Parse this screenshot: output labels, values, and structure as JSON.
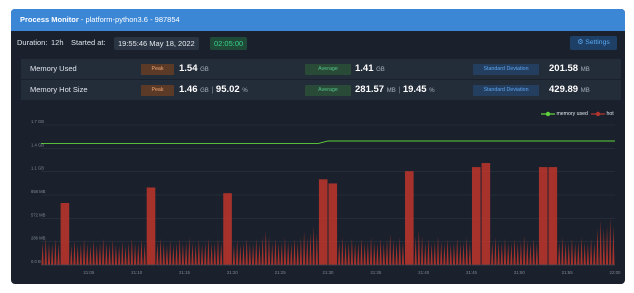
{
  "titlebar": {
    "app_name": "Process Monitor",
    "separator": " - ",
    "process": "platform-python3.6",
    "pid": "987854"
  },
  "toolbar": {
    "duration_label": "Duration:",
    "duration_value": "12h",
    "started_label": "Started at:",
    "started_value": "19:55:46 May 18, 2022",
    "elapsed": "02:05:00",
    "settings_label": "⚙ Settings"
  },
  "stats": {
    "memory_used": {
      "label": "Memory Used",
      "peak_badge": "Peak",
      "peak_value": "1.54",
      "peak_unit": "GB",
      "avg_badge": "Average",
      "avg_value": "1.41",
      "avg_unit": "GB",
      "std_badge": "Standard Deviation",
      "std_value": "201.58",
      "std_unit": "MB"
    },
    "memory_hot": {
      "label": "Memory Hot Size",
      "peak_badge": "Peak",
      "peak_value": "1.46",
      "peak_unit": "GB",
      "peak_sep": "|",
      "peak_pct": "95.02",
      "peak_pct_unit": "%",
      "avg_badge": "Average",
      "avg_value": "281.57",
      "avg_unit": "MB",
      "avg_sep": "|",
      "avg_pct": "19.45",
      "avg_pct_unit": "%",
      "std_badge": "Standard Deviation",
      "std_value": "429.89",
      "std_unit": "MB"
    }
  },
  "colors": {
    "accent": "#3b87d6",
    "memory_used_line": "#5fd23d",
    "hot_area": "#b3342c",
    "panel": "#1a212c"
  },
  "chart_data": {
    "type": "area",
    "x_unit": "time",
    "y_unit": "MB",
    "y_ticks": [
      {
        "value": 0,
        "label": "0.0 B"
      },
      {
        "value": 286,
        "label": "286 MB"
      },
      {
        "value": 572,
        "label": "572 MB"
      },
      {
        "value": 858,
        "label": "858 MB"
      },
      {
        "value": 1144,
        "label": "1.1 GB"
      },
      {
        "value": 1430,
        "label": "1.4 GB"
      },
      {
        "value": 1716,
        "label": "1.7 GB"
      }
    ],
    "ylim": [
      0,
      1716
    ],
    "x_ticks": [
      "21:05",
      "21:10",
      "21:15",
      "21:20",
      "21:25",
      "21:30",
      "21:35",
      "21:40",
      "21:45",
      "21:50",
      "21:55",
      "22:00"
    ],
    "x_range": [
      "21:00",
      "22:00"
    ],
    "legend_position": "top-right",
    "grid": "horizontal",
    "series": [
      {
        "name": "memory used",
        "x": [
          "21:00",
          "21:29",
          "21:30",
          "22:00"
        ],
        "values": [
          1490,
          1490,
          1520,
          1520
        ]
      },
      {
        "name": "hot",
        "x": [
          "21:01",
          "21:02",
          "21:03",
          "21:04",
          "21:05",
          "21:06",
          "21:07",
          "21:08",
          "21:09",
          "21:10",
          "21:11",
          "21:12",
          "21:13",
          "21:14",
          "21:15",
          "21:16",
          "21:17",
          "21:18",
          "21:19",
          "21:20",
          "21:21",
          "21:22",
          "21:23",
          "21:24",
          "21:25",
          "21:26",
          "21:27",
          "21:28",
          "21:29",
          "21:30",
          "21:31",
          "21:32",
          "21:33",
          "21:34",
          "21:35",
          "21:36",
          "21:37",
          "21:38",
          "21:39",
          "21:40",
          "21:41",
          "21:42",
          "21:43",
          "21:44",
          "21:45",
          "21:46",
          "21:47",
          "21:48",
          "21:49",
          "21:50",
          "21:51",
          "21:52",
          "21:53",
          "21:54",
          "21:55",
          "21:56",
          "21:57",
          "21:58",
          "21:59",
          "22:00"
        ],
        "values": [
          330,
          320,
          760,
          300,
          320,
          300,
          330,
          310,
          290,
          330,
          320,
          950,
          330,
          300,
          330,
          340,
          310,
          330,
          330,
          880,
          310,
          330,
          320,
          420,
          330,
          340,
          330,
          410,
          480,
          1050,
          1000,
          340,
          330,
          330,
          340,
          330,
          380,
          340,
          1150,
          420,
          330,
          350,
          320,
          330,
          340,
          1200,
          1250,
          340,
          330,
          330,
          360,
          330,
          1200,
          1200,
          340,
          330,
          340,
          330,
          550,
          580
        ]
      }
    ]
  }
}
